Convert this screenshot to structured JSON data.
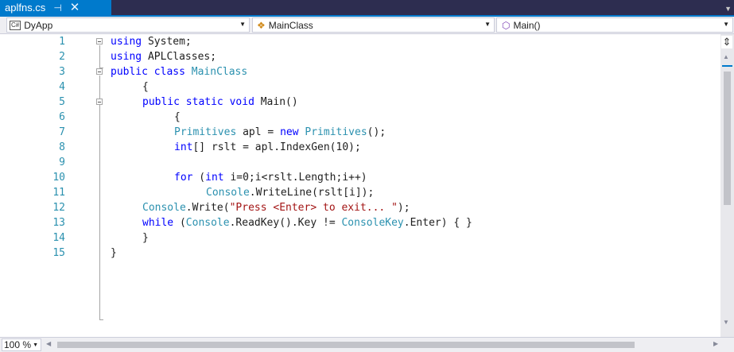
{
  "tab": {
    "filename": "aplfns.cs",
    "pin_glyph": "⊣",
    "close_glyph": "✕"
  },
  "navbar": {
    "project": {
      "badge": "C#",
      "label": "DyApp"
    },
    "class": {
      "label": "MainClass"
    },
    "member": {
      "label": "Main()"
    }
  },
  "editor": {
    "lines": [
      {
        "n": "1"
      },
      {
        "n": "2"
      },
      {
        "n": "3"
      },
      {
        "n": "4"
      },
      {
        "n": "5"
      },
      {
        "n": "6"
      },
      {
        "n": "7"
      },
      {
        "n": "8"
      },
      {
        "n": "9"
      },
      {
        "n": "10"
      },
      {
        "n": "11"
      },
      {
        "n": "12"
      },
      {
        "n": "13"
      },
      {
        "n": "14"
      },
      {
        "n": "15"
      }
    ],
    "tokens": {
      "using": "using",
      "System": "System;",
      "APLClasses": "APLClasses;",
      "public": "public",
      "class": "class",
      "MainClass": "MainClass",
      "open_brace": "{",
      "close_brace": "}",
      "static": "static",
      "void": "void",
      "Main": "Main()",
      "Primitives": "Primitives",
      "apl_assign": "apl = ",
      "new": "new",
      "ctor_call": "();",
      "int": "int",
      "rslt_decl": "[] rslt = apl.IndexGen(10);",
      "for": "for",
      "for_open": " (",
      "for_rest": " i=0;i<rslt.Length;i++)",
      "Console": "Console",
      "writeline_call": ".WriteLine(rslt[i]);",
      "write_call": ".Write(",
      "press_string": "\"Press <Enter> to exit... \"",
      "write_close": ");",
      "while": "while",
      "while_open": " (",
      "readkey_call": ".ReadKey().Key != ",
      "ConsoleKey": "ConsoleKey",
      "while_rest": ".Enter) { }"
    }
  },
  "bottombar": {
    "zoom": "100 %"
  },
  "colors": {
    "keyword": "#0000ff",
    "type": "#2b91af",
    "string": "#a31515",
    "line_number": "#2b91af",
    "tab_accent": "#007acc"
  }
}
